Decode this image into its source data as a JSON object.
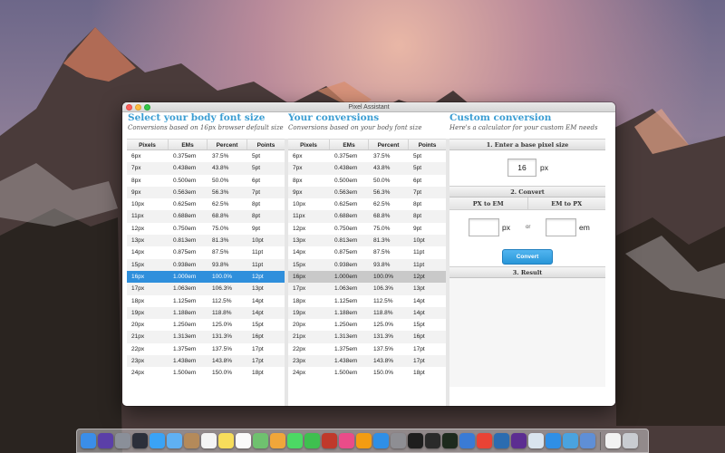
{
  "window": {
    "title": "Pixel Assistant"
  },
  "body_font": {
    "title": "Select your body font size",
    "subtitle": "Conversions based on 16px browser default size",
    "columns": [
      "Pixels",
      "EMs",
      "Percent",
      "Points"
    ],
    "selected_row": "16px",
    "rows": [
      [
        "6px",
        "0.375em",
        "37.5%",
        "5pt"
      ],
      [
        "7px",
        "0.438em",
        "43.8%",
        "5pt"
      ],
      [
        "8px",
        "0.500em",
        "50.0%",
        "6pt"
      ],
      [
        "9px",
        "0.563em",
        "56.3%",
        "7pt"
      ],
      [
        "10px",
        "0.625em",
        "62.5%",
        "8pt"
      ],
      [
        "11px",
        "0.688em",
        "68.8%",
        "8pt"
      ],
      [
        "12px",
        "0.750em",
        "75.0%",
        "9pt"
      ],
      [
        "13px",
        "0.813em",
        "81.3%",
        "10pt"
      ],
      [
        "14px",
        "0.875em",
        "87.5%",
        "11pt"
      ],
      [
        "15px",
        "0.938em",
        "93.8%",
        "11pt"
      ],
      [
        "16px",
        "1.000em",
        "100.0%",
        "12pt"
      ],
      [
        "17px",
        "1.063em",
        "106.3%",
        "13pt"
      ],
      [
        "18px",
        "1.125em",
        "112.5%",
        "14pt"
      ],
      [
        "19px",
        "1.188em",
        "118.8%",
        "14pt"
      ],
      [
        "20px",
        "1.250em",
        "125.0%",
        "15pt"
      ],
      [
        "21px",
        "1.313em",
        "131.3%",
        "16pt"
      ],
      [
        "22px",
        "1.375em",
        "137.5%",
        "17pt"
      ],
      [
        "23px",
        "1.438em",
        "143.8%",
        "17pt"
      ],
      [
        "24px",
        "1.500em",
        "150.0%",
        "18pt"
      ]
    ]
  },
  "your_conversions": {
    "title": "Your conversions",
    "subtitle": "Conversions based on your body font size",
    "columns": [
      "Pixels",
      "EMs",
      "Percent",
      "Points"
    ],
    "selected_row": "16px",
    "rows": [
      [
        "6px",
        "0.375em",
        "37.5%",
        "5pt"
      ],
      [
        "7px",
        "0.438em",
        "43.8%",
        "5pt"
      ],
      [
        "8px",
        "0.500em",
        "50.0%",
        "6pt"
      ],
      [
        "9px",
        "0.563em",
        "56.3%",
        "7pt"
      ],
      [
        "10px",
        "0.625em",
        "62.5%",
        "8pt"
      ],
      [
        "11px",
        "0.688em",
        "68.8%",
        "8pt"
      ],
      [
        "12px",
        "0.750em",
        "75.0%",
        "9pt"
      ],
      [
        "13px",
        "0.813em",
        "81.3%",
        "10pt"
      ],
      [
        "14px",
        "0.875em",
        "87.5%",
        "11pt"
      ],
      [
        "15px",
        "0.938em",
        "93.8%",
        "11pt"
      ],
      [
        "16px",
        "1.000em",
        "100.0%",
        "12pt"
      ],
      [
        "17px",
        "1.063em",
        "106.3%",
        "13pt"
      ],
      [
        "18px",
        "1.125em",
        "112.5%",
        "14pt"
      ],
      [
        "19px",
        "1.188em",
        "118.8%",
        "14pt"
      ],
      [
        "20px",
        "1.250em",
        "125.0%",
        "15pt"
      ],
      [
        "21px",
        "1.313em",
        "131.3%",
        "16pt"
      ],
      [
        "22px",
        "1.375em",
        "137.5%",
        "17pt"
      ],
      [
        "23px",
        "1.438em",
        "143.8%",
        "17pt"
      ],
      [
        "24px",
        "1.500em",
        "150.0%",
        "18pt"
      ]
    ]
  },
  "custom": {
    "title": "Custom conversion",
    "subtitle": "Here's a calculator for your custom EM needs",
    "step1": "1. Enter a base pixel size",
    "base_value": "16",
    "base_unit": "px",
    "step2": "2. Convert",
    "px_to_em": "PX to EM",
    "em_to_px": "EM to PX",
    "px_unit": "px",
    "or_label": "or",
    "em_unit": "em",
    "px_value": "",
    "em_value": "",
    "convert_label": "Convert",
    "step3": "3. Result"
  },
  "colors": {
    "accent": "#3c9ed3",
    "selected_blue": "#2f8fdc",
    "selected_grey": "#c9c9c9"
  },
  "dock": {
    "apps": [
      {
        "name": "finder-icon",
        "color": "#3b8ee8"
      },
      {
        "name": "siri-icon",
        "color": "#5b3fa8"
      },
      {
        "name": "launchpad-icon",
        "color": "#8a8f99"
      },
      {
        "name": "mission-control-icon",
        "color": "#2c2f3a"
      },
      {
        "name": "safari-icon",
        "color": "#3aa3f5"
      },
      {
        "name": "mail-icon",
        "color": "#5fb0f2"
      },
      {
        "name": "contacts-icon",
        "color": "#b48a5a"
      },
      {
        "name": "calendar-icon",
        "color": "#f4f4f4"
      },
      {
        "name": "notes-icon",
        "color": "#f7dd5b"
      },
      {
        "name": "reminders-icon",
        "color": "#fafafa"
      },
      {
        "name": "maps-icon",
        "color": "#6fc16f"
      },
      {
        "name": "photos-icon",
        "color": "#f0a63a"
      },
      {
        "name": "messages-icon",
        "color": "#4cd964"
      },
      {
        "name": "facetime-icon",
        "color": "#3ec04f"
      },
      {
        "name": "photo-booth-icon",
        "color": "#c0392b"
      },
      {
        "name": "itunes-icon",
        "color": "#ea4c89"
      },
      {
        "name": "ibooks-icon",
        "color": "#f39c12"
      },
      {
        "name": "app-store-icon",
        "color": "#2f8fe6"
      },
      {
        "name": "system-preferences-icon",
        "color": "#8e8e93"
      },
      {
        "name": "terminal-icon",
        "color": "#1e1e1e"
      },
      {
        "name": "console-icon",
        "color": "#2a2a2a"
      },
      {
        "name": "activity-monitor-icon",
        "color": "#1d2a1d"
      },
      {
        "name": "xcode-icon",
        "color": "#3a7bd5"
      },
      {
        "name": "chrome-icon",
        "color": "#e94335"
      },
      {
        "name": "network-icon",
        "color": "#2b6cb0"
      },
      {
        "name": "visual-studio-icon",
        "color": "#5c2d91"
      },
      {
        "name": "preview-icon",
        "color": "#d9e4ef"
      },
      {
        "name": "app-store-alt-icon",
        "color": "#2f8fe6"
      },
      {
        "name": "pixel-assistant-icon",
        "color": "#4aa3df"
      },
      {
        "name": "migration-icon",
        "color": "#5f8fd6"
      }
    ],
    "trailing": [
      {
        "name": "document-icon",
        "color": "#f2f2f2"
      },
      {
        "name": "trash-icon",
        "color": "#c9ccd1"
      }
    ]
  }
}
